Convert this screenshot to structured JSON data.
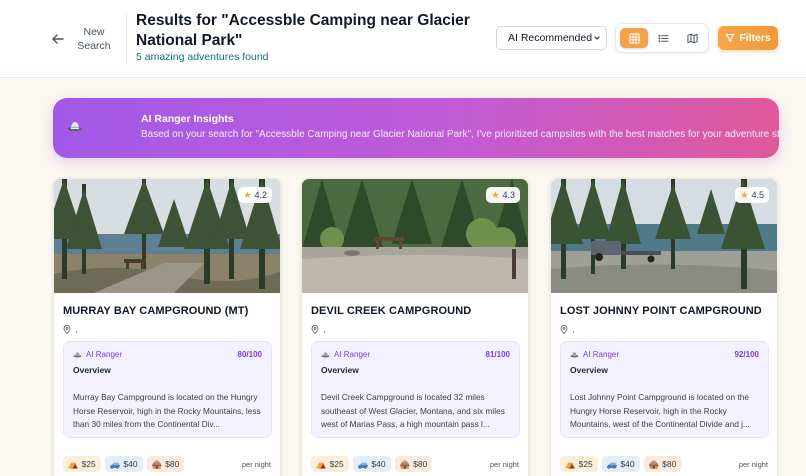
{
  "header": {
    "back_label": "New Search",
    "title": "Results for \"Accessble Camping near Glacier National Park\"",
    "subtitle": "5 amazing adventures found",
    "sort_value": "AI Recommended",
    "filters_label": "Filters",
    "view_modes": [
      "grid",
      "list",
      "map"
    ],
    "active_view": "grid",
    "accent_color": "#f5a04a"
  },
  "insight": {
    "heading": "AI Ranger Insights",
    "body": "Based on your search for \"Accessble Camping near Glacier National Park\", I've prioritized campsites with the best matches for your adventure style."
  },
  "cards": [
    {
      "rating": "4.2",
      "name": "MURRAY BAY CAMPGROUND (MT)",
      "location": ",",
      "ranger_label": "AI Ranger",
      "score": "80/100",
      "overview_label": "Overview",
      "description": "Murray Bay Campground is located on the Hungry Horse Reservoir, high in the Rocky Mountains, less than 30 miles from the Continental Div...",
      "prices": {
        "tent": "$25",
        "rv": "$40",
        "cabin": "$80"
      },
      "per_night": "per night"
    },
    {
      "rating": "4.3",
      "name": "DEVIL CREEK CAMPGROUND",
      "location": ",",
      "ranger_label": "AI Ranger",
      "score": "81/100",
      "overview_label": "Overview",
      "description": "Devil Creek Campground is located 32 miles southeast of West Glacier, Montana, and six miles west of Marias Pass, a high mountain pass l...",
      "prices": {
        "tent": "$25",
        "rv": "$40",
        "cabin": "$80"
      },
      "per_night": "per night"
    },
    {
      "rating": "4.5",
      "name": "LOST JOHNNY POINT CAMPGROUND",
      "location": ",",
      "ranger_label": "AI Ranger",
      "score": "92/100",
      "overview_label": "Overview",
      "description": "Lost Johnny Point Campground is located on the Hungry Horse Reservoir, high in the Rocky Mountains, west of the Continental Divide and j...",
      "prices": {
        "tent": "$25",
        "rv": "$40",
        "cabin": "$80"
      },
      "per_night": "per night"
    }
  ]
}
